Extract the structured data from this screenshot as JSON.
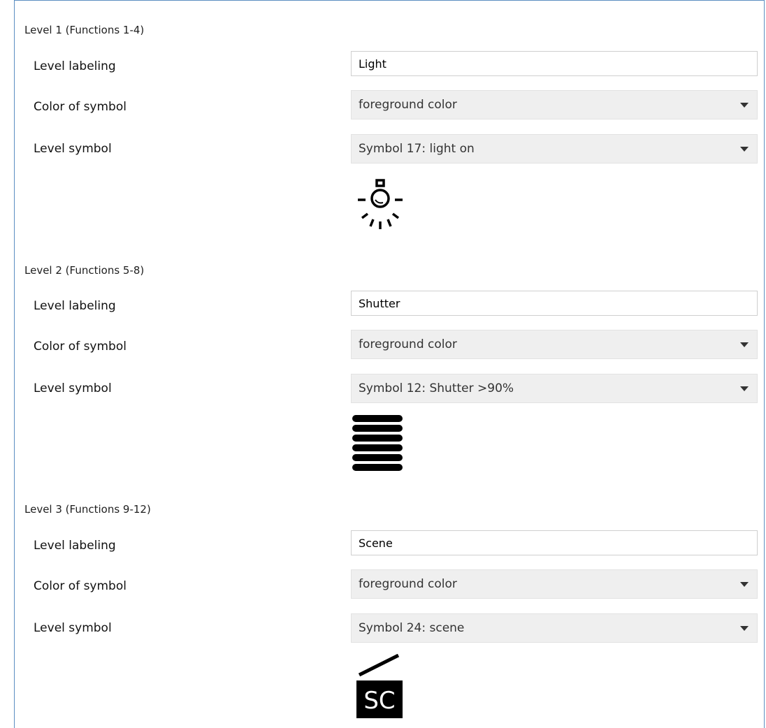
{
  "levels": [
    {
      "title": "Level 1 (Functions 1-4)",
      "labeling_label": "Level labeling",
      "labeling_value": "Light",
      "color_label": "Color of symbol",
      "color_value": "foreground color",
      "symbol_label": "Level symbol",
      "symbol_value": "Symbol 17: light on",
      "symbol_icon": "light-bulb-on-icon"
    },
    {
      "title": "Level 2 (Functions 5-8)",
      "labeling_label": "Level labeling",
      "labeling_value": "Shutter",
      "color_label": "Color of symbol",
      "color_value": "foreground color",
      "symbol_label": "Level symbol",
      "symbol_value": "Symbol 12: Shutter >90%",
      "symbol_icon": "shutter-closed-icon"
    },
    {
      "title": "Level 3 (Functions 9-12)",
      "labeling_label": "Level labeling",
      "labeling_value": "Scene",
      "color_label": "Color of symbol",
      "color_value": "foreground color",
      "symbol_label": "Level symbol",
      "symbol_value": "Symbol 24: scene",
      "symbol_icon": "scene-clapperboard-icon",
      "symbol_icon_text": "SC"
    }
  ],
  "colors": {
    "frame_border": "#5b8ec1",
    "select_background": "#efefef",
    "input_border": "#cfcfcf"
  }
}
